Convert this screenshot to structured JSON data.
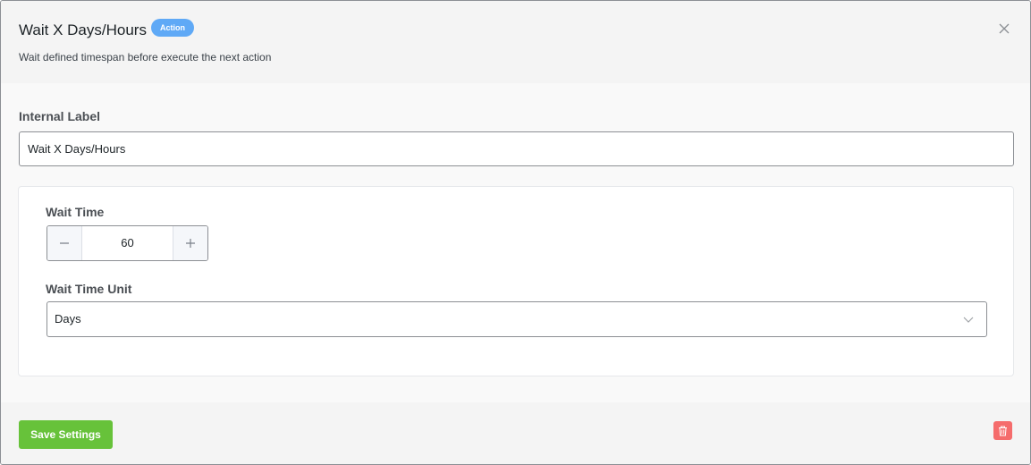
{
  "header": {
    "title": "Wait X Days/Hours",
    "badge": "Action",
    "subtitle": "Wait defined timespan before execute the next action"
  },
  "internal_label": {
    "label": "Internal Label",
    "value": "Wait X Days/Hours"
  },
  "wait_time": {
    "label": "Wait Time",
    "value": "60",
    "minus_icon": "minus-icon",
    "plus_icon": "plus-icon"
  },
  "wait_time_unit": {
    "label": "Wait Time Unit",
    "selected": "Days",
    "icon": "chevron-down-icon"
  },
  "footer": {
    "save_label": "Save Settings",
    "delete_icon": "trash-icon"
  },
  "colors": {
    "badge": "#5fa9f6",
    "save": "#67c23a",
    "delete": "#f56c6c"
  }
}
